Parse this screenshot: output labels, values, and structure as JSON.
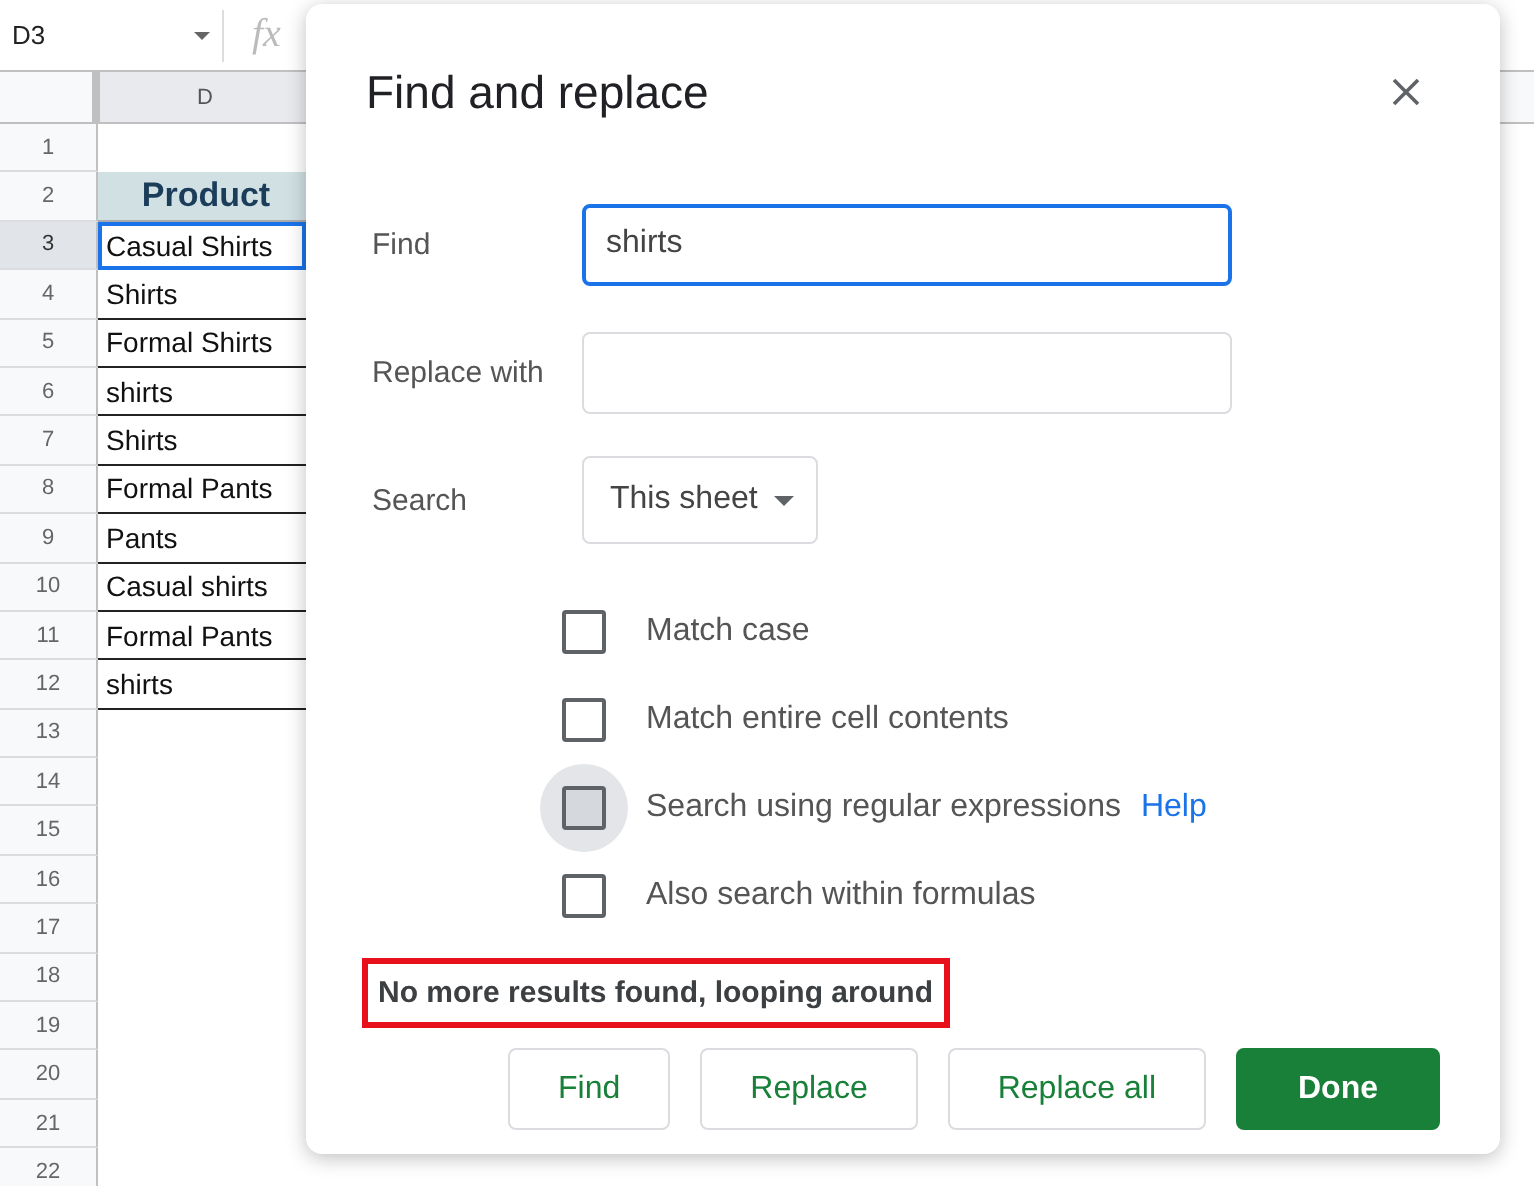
{
  "name_box": {
    "value": "D3"
  },
  "formula_icon": "fx",
  "column_header": "D",
  "rows": [
    {
      "number": "1",
      "value": "",
      "kind": "empty",
      "selected": false
    },
    {
      "number": "2",
      "value": "Product",
      "kind": "header",
      "selected": false
    },
    {
      "number": "3",
      "value": "Casual Shirts",
      "kind": "data",
      "selected": true
    },
    {
      "number": "4",
      "value": "Shirts",
      "kind": "data",
      "selected": false
    },
    {
      "number": "5",
      "value": "Formal Shirts",
      "kind": "data",
      "selected": false
    },
    {
      "number": "6",
      "value": "shirts",
      "kind": "data",
      "selected": false
    },
    {
      "number": "7",
      "value": "Shirts",
      "kind": "data",
      "selected": false
    },
    {
      "number": "8",
      "value": "Formal Pants",
      "kind": "data",
      "selected": false
    },
    {
      "number": "9",
      "value": "Pants",
      "kind": "data",
      "selected": false
    },
    {
      "number": "10",
      "value": "Casual shirts",
      "kind": "data",
      "selected": false
    },
    {
      "number": "11",
      "value": "Formal Pants",
      "kind": "data",
      "selected": false
    },
    {
      "number": "12",
      "value": "shirts",
      "kind": "data",
      "selected": false
    },
    {
      "number": "13",
      "value": "",
      "kind": "empty",
      "selected": false
    },
    {
      "number": "14",
      "value": "",
      "kind": "empty",
      "selected": false
    },
    {
      "number": "15",
      "value": "",
      "kind": "empty",
      "selected": false
    },
    {
      "number": "16",
      "value": "",
      "kind": "empty",
      "selected": false
    },
    {
      "number": "17",
      "value": "",
      "kind": "empty",
      "selected": false
    },
    {
      "number": "18",
      "value": "",
      "kind": "empty",
      "selected": false
    },
    {
      "number": "19",
      "value": "",
      "kind": "empty",
      "selected": false
    },
    {
      "number": "20",
      "value": "",
      "kind": "empty",
      "selected": false
    },
    {
      "number": "21",
      "value": "",
      "kind": "empty",
      "selected": false
    },
    {
      "number": "22",
      "value": "",
      "kind": "empty",
      "selected": false
    }
  ],
  "dialog": {
    "title": "Find and replace",
    "find": {
      "label": "Find",
      "value": "shirts",
      "focused": true
    },
    "replace": {
      "label": "Replace with",
      "focused": false
    },
    "search": {
      "label": "Search",
      "value": "This sheet"
    },
    "options": [
      {
        "label": "Match case",
        "checked": false,
        "hovered": false
      },
      {
        "label": "Match entire cell contents",
        "checked": false,
        "hovered": false
      },
      {
        "label": "Search using regular expressions",
        "checked": false,
        "hovered": true,
        "link": "Help"
      },
      {
        "label": "Also search within formulas",
        "checked": false,
        "hovered": false
      }
    ],
    "message": {
      "text": "No more results found, looping around",
      "highlighted": true
    },
    "buttons": [
      {
        "label": "Find",
        "primary": false
      },
      {
        "label": "Replace",
        "primary": false
      },
      {
        "label": "Replace all",
        "primary": false
      },
      {
        "label": "Done",
        "primary": true
      }
    ]
  }
}
